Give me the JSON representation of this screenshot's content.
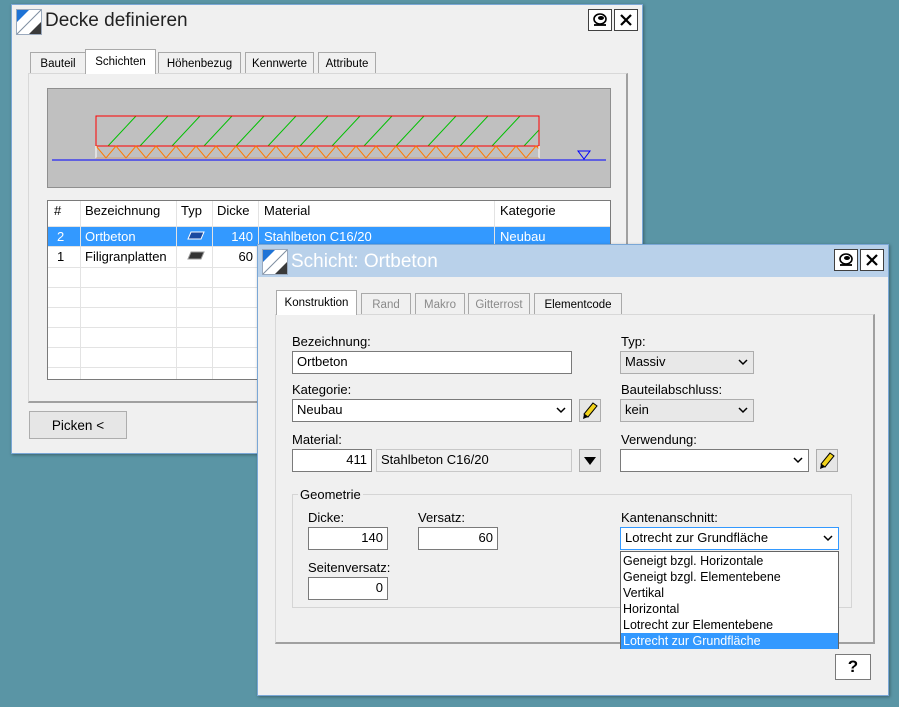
{
  "main_window": {
    "title": "Decke definieren",
    "tabs": [
      "Bauteil",
      "Schichten",
      "Höhenbezug",
      "Kennwerte",
      "Attribute"
    ],
    "active_tab": "Schichten",
    "table": {
      "columns": [
        "#",
        "Bezeichnung",
        "Typ",
        "Dicke",
        "Material",
        "Kategorie"
      ],
      "rows": [
        {
          "num": "2",
          "name": "Ortbeton",
          "type": "plate-icon",
          "thickness": "140",
          "material": "Stahlbeton C16/20",
          "category": "Neubau",
          "selected": true
        },
        {
          "num": "1",
          "name": "Filigranplatten",
          "type": "plate-icon",
          "thickness": "60",
          "material": "",
          "category": "",
          "selected": false
        }
      ]
    },
    "pick_button": "Picken <",
    "colors": {
      "section_outline": "#ff0000",
      "hatch": "#00c000",
      "reference_line": "#0000ff"
    }
  },
  "layer_dialog": {
    "title": "Schicht: Ortbeton",
    "tabs": [
      {
        "label": "Konstruktion",
        "state": "active"
      },
      {
        "label": "Rand",
        "state": "disabled"
      },
      {
        "label": "Makro",
        "state": "disabled"
      },
      {
        "label": "Gitterrost",
        "state": "disabled"
      },
      {
        "label": "Elementcode",
        "state": "normal"
      }
    ],
    "bezeichnung": {
      "label": "Bezeichnung:",
      "value": "Ortbeton"
    },
    "typ": {
      "label": "Typ:",
      "value": "Massiv"
    },
    "kategorie": {
      "label": "Kategorie:",
      "value": "Neubau"
    },
    "bauteilabschluss": {
      "label": "Bauteilabschluss:",
      "value": "kein"
    },
    "material": {
      "label": "Material:",
      "number": "411",
      "name": "Stahlbeton C16/20"
    },
    "verwendung": {
      "label": "Verwendung:",
      "value": ""
    },
    "geometrie": {
      "group_label": "Geometrie",
      "dicke": {
        "label": "Dicke:",
        "value": "140"
      },
      "versatz": {
        "label": "Versatz:",
        "value": "60"
      },
      "seitenversatz": {
        "label": "Seitenversatz:",
        "value": "0"
      }
    },
    "kantenanschnitt": {
      "label": "Kantenanschnitt:",
      "value": "Lotrecht zur Grundfläche",
      "options": [
        "Geneigt bzgl. Horizontale",
        "Geneigt bzgl. Elementebene",
        "Vertikal",
        "Horizontal",
        "Lotrecht zur Elementebene",
        "Lotrecht zur Grundfläche"
      ],
      "selected_index": 5
    },
    "help_button": "?"
  }
}
